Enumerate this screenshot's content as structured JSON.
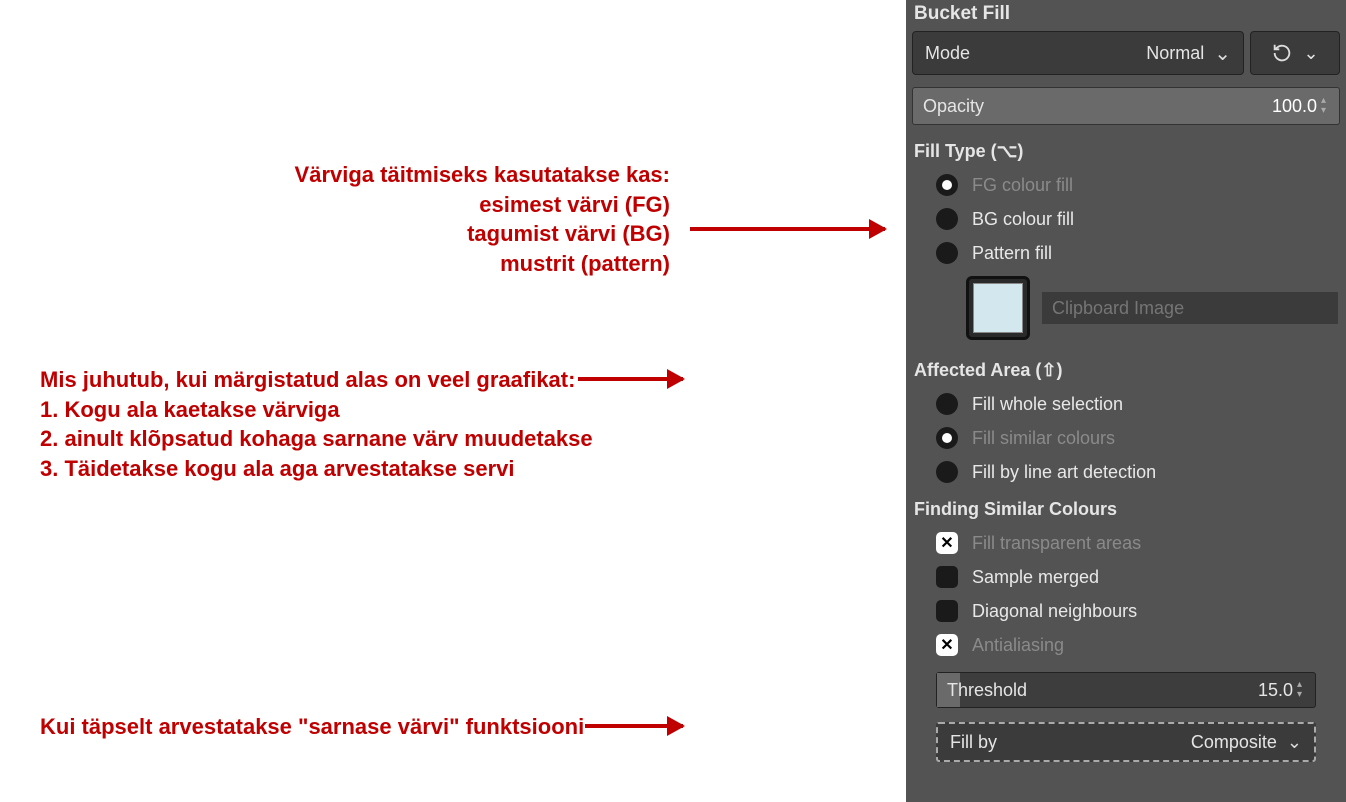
{
  "annotations": {
    "fill_type": {
      "line1": "Värviga täitmiseks kasutatakse kas:",
      "line2": "esimest värvi (FG)",
      "line3": "tagumist värvi (BG)",
      "line4": "mustrit (pattern)"
    },
    "affected": {
      "line1": "Mis juhutub, kui märgistatud alas on veel graafikat:",
      "line2": "1. Kogu ala kaetakse värviga",
      "line3": "2. ainult klõpsatud kohaga sarnane värv muudetakse",
      "line4": "3. Täidetakse kogu ala aga arvestatakse servi"
    },
    "threshold": "Kui täpselt arvestatakse \"sarnase värvi\" funktsiooni"
  },
  "panel": {
    "title": "Bucket Fill",
    "mode": {
      "label": "Mode",
      "value": "Normal"
    },
    "opacity": {
      "label": "Opacity",
      "value": "100.0"
    },
    "fill_type": {
      "header": "Fill Type  (⌥)",
      "fg": "FG colour fill",
      "bg": "BG colour fill",
      "pattern": "Pattern fill",
      "pattern_name": "Clipboard Image"
    },
    "affected_area": {
      "header": "Affected Area  (⇧)",
      "whole": "Fill whole selection",
      "similar": "Fill similar colours",
      "lineart": "Fill by line art detection"
    },
    "finding": {
      "header": "Finding Similar Colours",
      "transparent": "Fill transparent areas",
      "sample_merged": "Sample merged",
      "diagonal": "Diagonal neighbours",
      "antialiasing": "Antialiasing"
    },
    "threshold": {
      "label": "Threshold",
      "value": "15.0"
    },
    "fill_by": {
      "label": "Fill by",
      "value": "Composite"
    }
  }
}
